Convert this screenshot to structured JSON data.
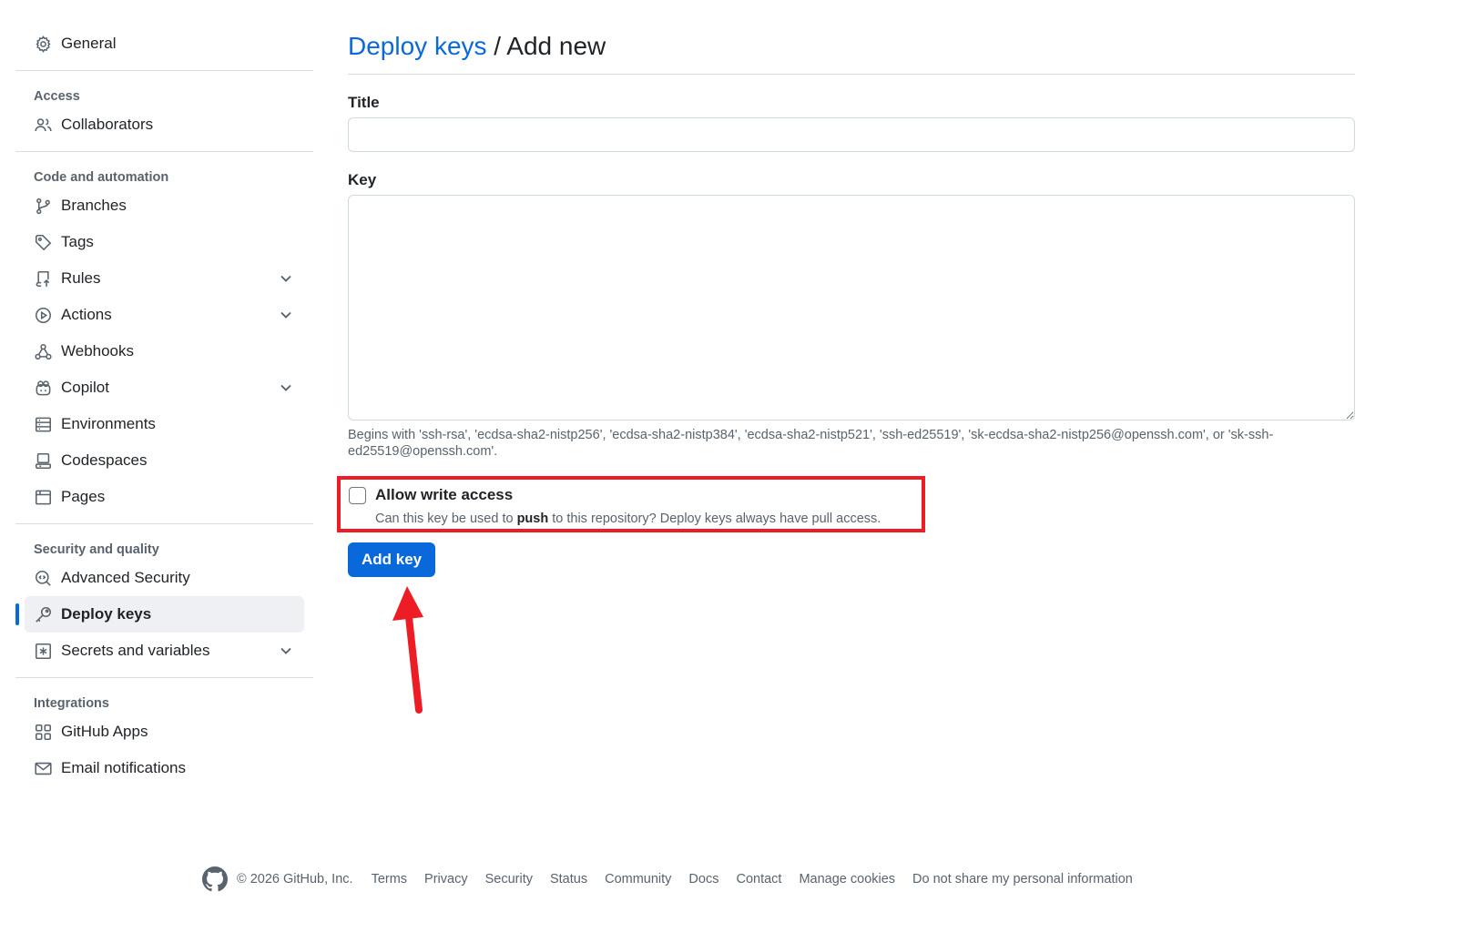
{
  "sidebar": {
    "general": "General",
    "access_title": "Access",
    "collaborators": "Collaborators",
    "code_title": "Code and automation",
    "branches": "Branches",
    "tags": "Tags",
    "rules": "Rules",
    "actions": "Actions",
    "webhooks": "Webhooks",
    "copilot": "Copilot",
    "environments": "Environments",
    "codespaces": "Codespaces",
    "pages": "Pages",
    "security_title": "Security and quality",
    "advanced_security": "Advanced Security",
    "deploy_keys": "Deploy keys",
    "secrets": "Secrets and variables",
    "integrations_title": "Integrations",
    "github_apps": "GitHub Apps",
    "email_notifications": "Email notifications"
  },
  "main": {
    "breadcrumb_link": "Deploy keys",
    "breadcrumb_rest": " / Add new",
    "title_label": "Title",
    "title_value": "",
    "key_label": "Key",
    "key_value": "",
    "key_hint": "Begins with 'ssh-rsa', 'ecdsa-sha2-nistp256', 'ecdsa-sha2-nistp384', 'ecdsa-sha2-nistp521', 'ssh-ed25519', 'sk-ecdsa-sha2-nistp256@openssh.com', or 'sk-ssh-ed25519@openssh.com'.",
    "write_access_label": "Allow write access",
    "write_access_desc_before": "Can this key be used to ",
    "write_access_desc_bold": "push",
    "write_access_desc_after": " to this repository? Deploy keys always have pull access.",
    "write_access_checked": false,
    "add_key_button": "Add key"
  },
  "footer": {
    "copyright": "© 2026 GitHub, Inc.",
    "links": [
      "Terms",
      "Privacy",
      "Security",
      "Status",
      "Community",
      "Docs",
      "Contact",
      "Manage cookies",
      "Do not share my personal information"
    ]
  },
  "colors": {
    "accent": "#0969da",
    "annotation": "#ee1c24",
    "muted": "#59636e"
  },
  "icons": {
    "general": "gear-icon",
    "collaborators": "people-icon",
    "branches": "git-branch-icon",
    "tags": "tag-icon",
    "rules": "repo-push-icon",
    "actions": "play-icon",
    "webhooks": "webhook-icon",
    "copilot": "copilot-icon",
    "environments": "server-icon",
    "codespaces": "codespaces-icon",
    "pages": "browser-icon",
    "advanced_security": "codescan-icon",
    "deploy_keys": "key-icon",
    "secrets": "key-asterisk-icon",
    "github_apps": "apps-icon",
    "email_notifications": "mail-icon",
    "footer_logo": "github-mark-icon"
  }
}
